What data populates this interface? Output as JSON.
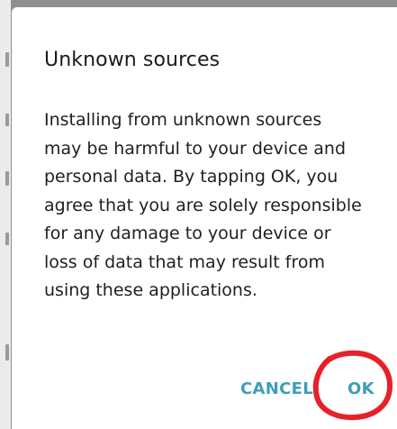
{
  "dialog": {
    "title": "Unknown sources",
    "message": "Installing from unknown sources may be harmful to your device and personal data. By tapping OK, you agree that you are solely responsible for any damage to your device or loss of data that may result from using these applications.",
    "buttons": {
      "cancel_label": "CANCEL",
      "ok_label": "OK"
    }
  },
  "colors": {
    "accent": "#3b9fb8",
    "annotation": "#e8202b",
    "scrim": "#8f8f8f",
    "dialog_background": "#ffffff"
  }
}
